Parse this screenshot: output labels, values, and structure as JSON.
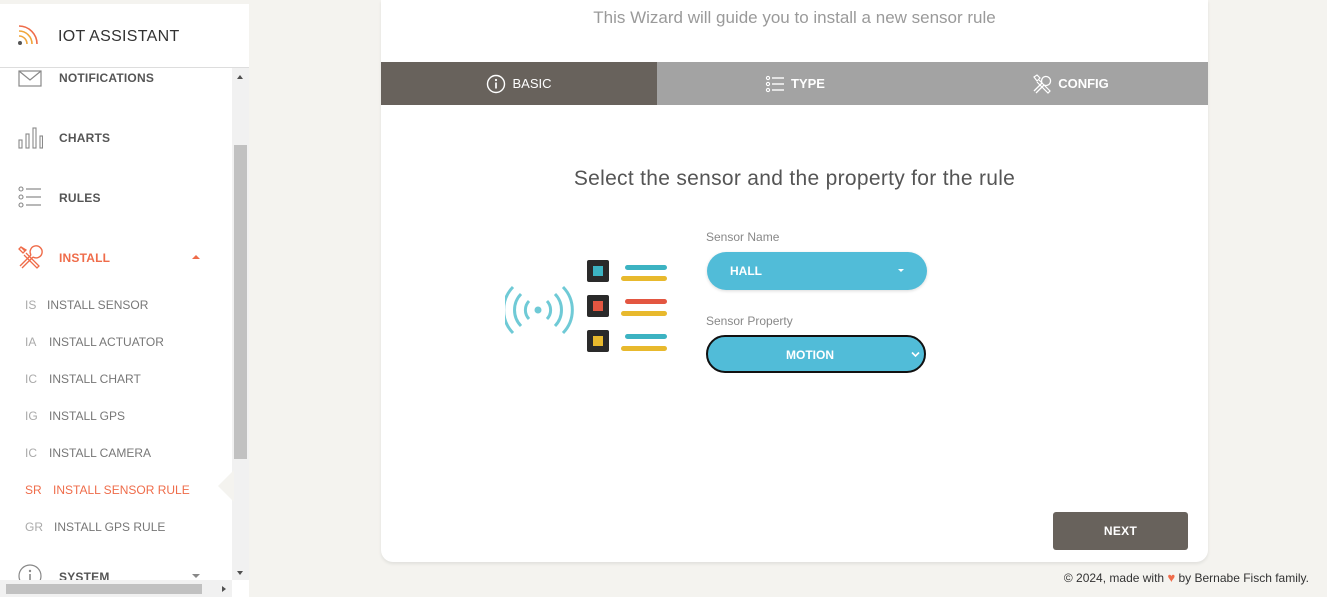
{
  "app": {
    "title": "IOT ASSISTANT"
  },
  "sidebar": {
    "items": [
      {
        "label": "NOTIFICATIONS",
        "icon": "mail-icon"
      },
      {
        "label": "CHARTS",
        "icon": "bar-chart-icon"
      },
      {
        "label": "RULES",
        "icon": "list-icon"
      },
      {
        "label": "INSTALL",
        "icon": "tools-icon"
      },
      {
        "label": "SYSTEM",
        "icon": "info-icon"
      }
    ],
    "install_sub": [
      {
        "abbr": "IS",
        "label": "INSTALL SENSOR"
      },
      {
        "abbr": "IA",
        "label": "INSTALL ACTUATOR"
      },
      {
        "abbr": "IC",
        "label": "INSTALL CHART"
      },
      {
        "abbr": "IG",
        "label": "INSTALL GPS"
      },
      {
        "abbr": "IC",
        "label": "INSTALL CAMERA"
      },
      {
        "abbr": "SR",
        "label": "INSTALL SENSOR RULE"
      },
      {
        "abbr": "GR",
        "label": "INSTALL GPS RULE"
      }
    ]
  },
  "wizard": {
    "subtitle": "This Wizard will guide you to install a new sensor rule",
    "tabs": [
      {
        "label": "BASIC",
        "icon": "info-icon"
      },
      {
        "label": "TYPE",
        "icon": "list-icon"
      },
      {
        "label": "CONFIG",
        "icon": "tools-icon"
      }
    ],
    "step_title": "Select the sensor and the property for the rule",
    "sensor_name": {
      "label": "Sensor Name",
      "value": "HALL"
    },
    "sensor_property": {
      "label": "Sensor Property",
      "value": "MOTION"
    },
    "next_label": "NEXT"
  },
  "footer": {
    "prefix": "© 2024, made with",
    "heart": "♥",
    "suffix": "by Bernabe Fisch family."
  },
  "colors": {
    "accent": "#ef6c4a",
    "tab_active": "#68625c",
    "tab_inactive": "#a3a3a3",
    "button_blue": "#51bcd8"
  }
}
